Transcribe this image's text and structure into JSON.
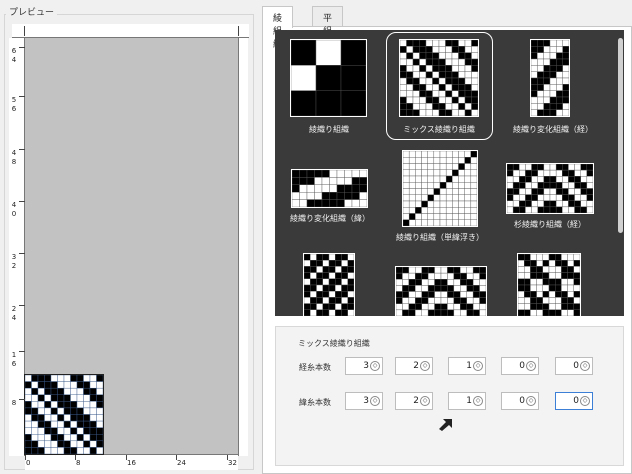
{
  "preview": {
    "legend": "プレビュー",
    "left_ticks": [
      {
        "top": "6",
        "bottom": "4"
      },
      {
        "top": "5",
        "bottom": "6"
      },
      {
        "top": "4",
        "bottom": "8"
      },
      {
        "top": "4",
        "bottom": "0"
      },
      {
        "top": "3",
        "bottom": "2"
      },
      {
        "top": "2",
        "bottom": "4"
      },
      {
        "top": "1",
        "bottom": "6"
      },
      {
        "top": "8",
        "bottom": ""
      }
    ],
    "bottom_ticks": [
      "0",
      "8",
      "16",
      "24",
      "32"
    ]
  },
  "tabs": [
    {
      "label": "綾組織",
      "active": true
    },
    {
      "label": "平組織",
      "active": false
    }
  ],
  "gallery": {
    "items": [
      {
        "label": "綾織り組織",
        "selected": false
      },
      {
        "label": "ミックス綾織り組織",
        "selected": true
      },
      {
        "label": "綾織り変化組織（経）",
        "selected": false
      },
      {
        "label": "綾織り変化組織（緯）",
        "selected": false
      },
      {
        "label": "綾織り組織（単緯浮き）",
        "selected": false
      },
      {
        "label": "杉綾織り組織（経）",
        "selected": false
      },
      {
        "label": "",
        "selected": false
      },
      {
        "label": "",
        "selected": false
      },
      {
        "label": "",
        "selected": false
      }
    ]
  },
  "settings": {
    "title": "ミックス綾織り組織",
    "rows": [
      {
        "label": "経糸本数",
        "values": [
          "3",
          "2",
          "1",
          "0",
          "0"
        ]
      },
      {
        "label": "緯糸本数",
        "values": [
          "3",
          "2",
          "1",
          "0",
          "0"
        ]
      }
    ],
    "focused": {
      "row": 1,
      "col": 4
    }
  },
  "colors": {
    "gallery_bg": "#3a3a3a",
    "preview_bg": "#c2c2c2",
    "focus": "#3b7fd6"
  },
  "icons": {
    "spin": "spin-updown-icon",
    "cursor": "mouse-pointer-icon"
  }
}
